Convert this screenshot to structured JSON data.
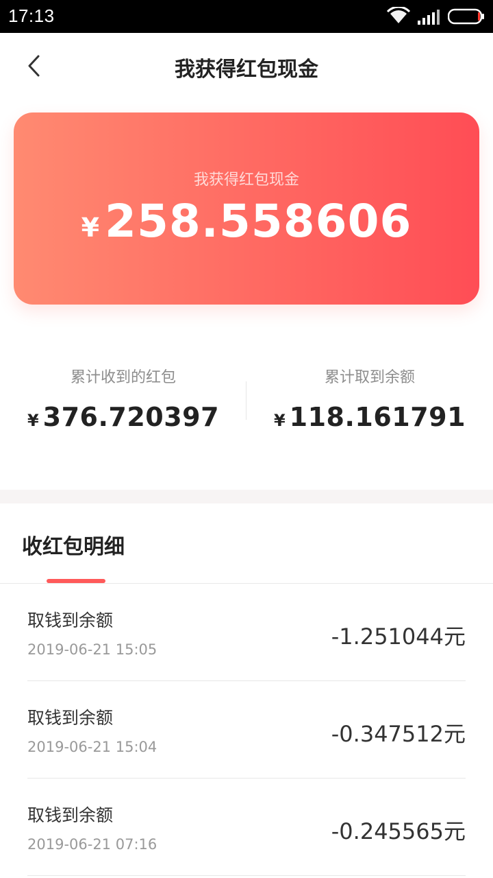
{
  "status_bar": {
    "time": "17:13",
    "icons": [
      "wifi-icon",
      "signal-icon",
      "battery-icon"
    ]
  },
  "header": {
    "title": "我获得红包现金",
    "back_icon": "chevron-left-icon"
  },
  "balance_card": {
    "label": "我获得红包现金",
    "currency": "¥",
    "amount": "258.558606",
    "gradient": [
      "#ff8a71",
      "#ff4d55"
    ]
  },
  "stats": {
    "received": {
      "label": "累计收到的红包",
      "currency": "¥",
      "value": "376.720397"
    },
    "withdrawn": {
      "label": "累计取到余额",
      "currency": "¥",
      "value": "118.161791"
    }
  },
  "detail_tab": {
    "label": "收红包明细",
    "accent": "#ff5a5a"
  },
  "records": [
    {
      "title": "取钱到余额",
      "time": "2019-06-21 15:05",
      "amount": "-1.251044元"
    },
    {
      "title": "取钱到余额",
      "time": "2019-06-21 15:04",
      "amount": "-0.347512元"
    },
    {
      "title": "取钱到余额",
      "time": "2019-06-21 07:16",
      "amount": "-0.245565元"
    }
  ]
}
